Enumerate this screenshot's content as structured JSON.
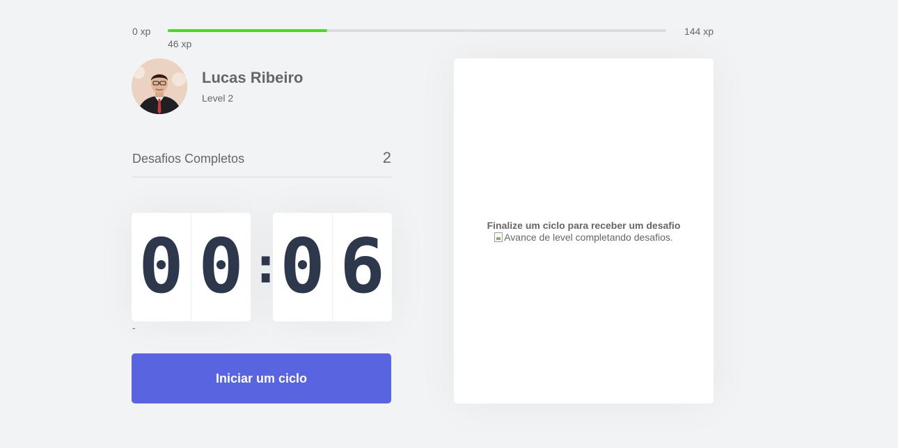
{
  "experience": {
    "min_label": "0 xp",
    "max_label": "144 xp",
    "current_label": "46 xp",
    "progress_fraction": 0.32,
    "colors": {
      "fill": "#4cd62b",
      "track": "#dcdde0"
    }
  },
  "profile": {
    "name": "Lucas Ribeiro",
    "level_label": "Level 2",
    "avatar_icon": "user-photo"
  },
  "completed_challenges": {
    "label": "Desafios Completos",
    "count": "2"
  },
  "countdown": {
    "minute_left": "0",
    "minute_right": "0",
    "separator": ":",
    "second_left": "0",
    "second_right": "6",
    "note": "-"
  },
  "start_button": {
    "label": "Iniciar um ciclo",
    "color": "#5965e0"
  },
  "challenge_box": {
    "title": "Finalize um ciclo para receber um desafio",
    "image_alt": "Avance de level completando desafios."
  }
}
